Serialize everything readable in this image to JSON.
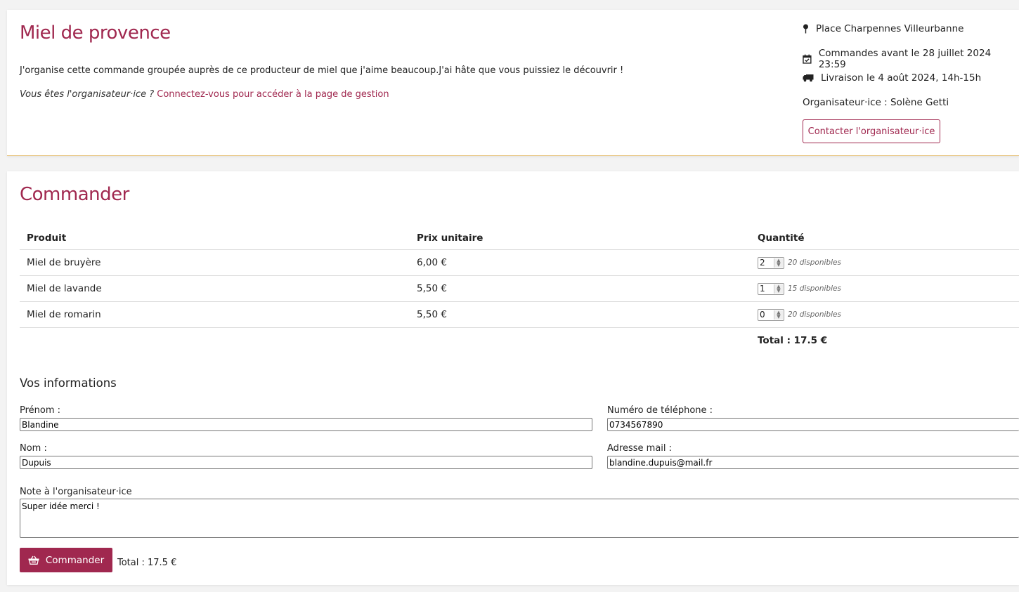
{
  "header": {
    "title": "Miel de provence",
    "description": "J'organise cette commande groupée auprès de ce producteur de miel que j'aime beaucoup.J'ai hâte que vous puissiez le découvrir !",
    "organizer_prompt": "Vous êtes l'organisateur·ice ?",
    "organizer_link": "Connectez-vous pour accéder à la page de gestion",
    "place": "Place Charpennes Villeurbanne",
    "deadline": "Commandes avant le 28 juillet 2024 23:59",
    "delivery": "Livraison le 4 août 2024, 14h-15h",
    "organizer": "Organisateur·ice : Solène Getti",
    "contact_label": "Contacter l'organisateur·ice",
    "icons": {
      "place": "map-pin-icon",
      "deadline": "calendar-check-icon",
      "delivery": "truck-icon"
    }
  },
  "order": {
    "title": "Commander",
    "columns": [
      "Produit",
      "Prix unitaire",
      "Quantité"
    ],
    "products": [
      {
        "name": "Miel de bruyère",
        "price": "6,00 €",
        "qty": "2",
        "available": "20 disponibles"
      },
      {
        "name": "Miel de lavande",
        "price": "5,50 €",
        "qty": "1",
        "available": "15 disponibles"
      },
      {
        "name": "Miel de romarin",
        "price": "5,50 €",
        "qty": "0",
        "available": "20 disponibles"
      }
    ],
    "total": "Total : 17.5 €"
  },
  "form": {
    "section_title": "Vos informations",
    "firstname_label": "Prénom :",
    "firstname_value": "Blandine",
    "phone_label": "Numéro de téléphone :",
    "phone_value": "0734567890",
    "lastname_label": "Nom :",
    "lastname_value": "Dupuis",
    "email_label": "Adresse mail :",
    "email_value": "blandine.dupuis@mail.fr",
    "note_label": "Note à l'organisateur·ice",
    "note_value": "Super idée merci !",
    "submit_label": "Commander",
    "submit_icon": "basket-icon",
    "footer_total": "Total : 17.5 €"
  },
  "colors": {
    "accent": "#a0284f",
    "background": "#f3f3f3",
    "card": "#ffffff",
    "card_border_bottom": "#e9c98a"
  }
}
